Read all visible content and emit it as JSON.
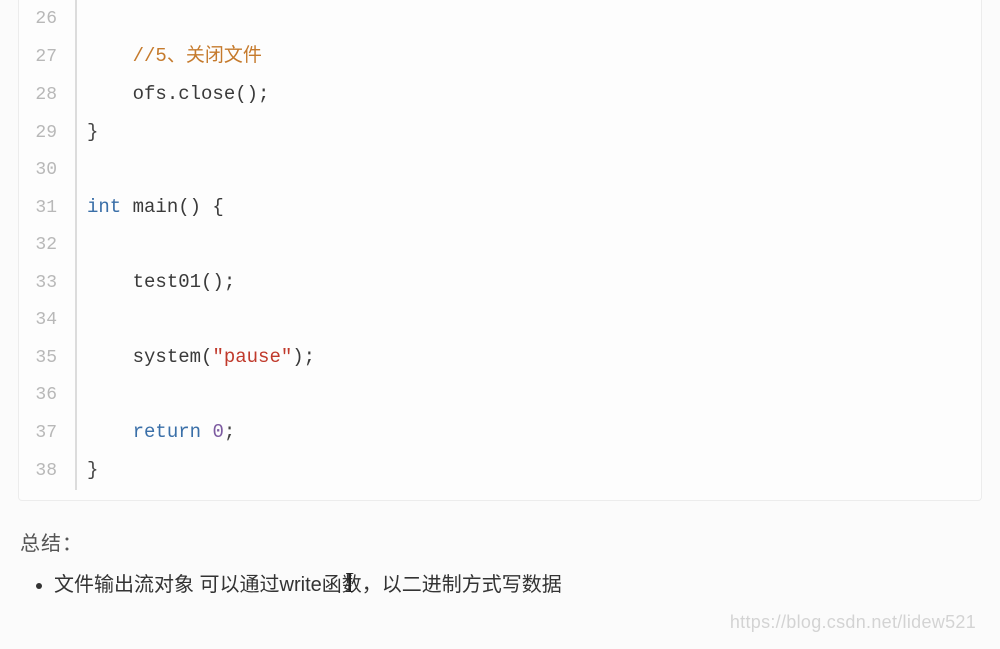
{
  "code": {
    "startLine": 26,
    "lines": [
      {
        "n": 26,
        "indent": 1,
        "segs": []
      },
      {
        "n": 27,
        "indent": 1,
        "segs": [
          {
            "t": "//5、关闭文件",
            "cls": "tok-comment"
          }
        ]
      },
      {
        "n": 28,
        "indent": 1,
        "segs": [
          {
            "t": "ofs.close();",
            "cls": "tok-func"
          }
        ]
      },
      {
        "n": 29,
        "indent": 0,
        "segs": [
          {
            "t": "}",
            "cls": "tok-punct"
          }
        ]
      },
      {
        "n": 30,
        "indent": 0,
        "segs": []
      },
      {
        "n": 31,
        "indent": 0,
        "segs": [
          {
            "t": "int",
            "cls": "tok-keyword"
          },
          {
            "t": " main() {",
            "cls": "tok-func"
          }
        ]
      },
      {
        "n": 32,
        "indent": 0,
        "segs": []
      },
      {
        "n": 33,
        "indent": 1,
        "segs": [
          {
            "t": "test01();",
            "cls": "tok-func"
          }
        ]
      },
      {
        "n": 34,
        "indent": 0,
        "segs": []
      },
      {
        "n": 35,
        "indent": 1,
        "segs": [
          {
            "t": "system(",
            "cls": "tok-func"
          },
          {
            "t": "\"pause\"",
            "cls": "tok-string"
          },
          {
            "t": ");",
            "cls": "tok-func"
          }
        ]
      },
      {
        "n": 36,
        "indent": 0,
        "segs": []
      },
      {
        "n": 37,
        "indent": 1,
        "segs": [
          {
            "t": "return",
            "cls": "tok-keyword"
          },
          {
            "t": " ",
            "cls": ""
          },
          {
            "t": "0",
            "cls": "tok-number"
          },
          {
            "t": ";",
            "cls": "tok-punct"
          }
        ]
      },
      {
        "n": 38,
        "indent": 0,
        "segs": [
          {
            "t": "}",
            "cls": "tok-punct"
          }
        ]
      }
    ]
  },
  "summary": {
    "title": "总结：",
    "bullet1": "文件输出流对象 可以通过write函数，以二进制方式写数据"
  },
  "watermark": "https://blog.csdn.net/lidew521",
  "caret": "I"
}
